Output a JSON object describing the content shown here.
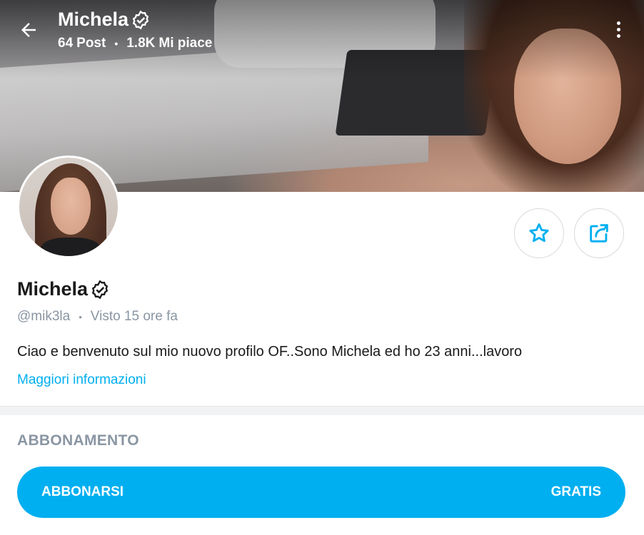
{
  "header": {
    "name": "Michela",
    "posts_count": "64",
    "posts_label": "Post",
    "separator": "•",
    "likes_count": "1.8K",
    "likes_label": "Mi piace"
  },
  "profile": {
    "name": "Michela",
    "handle": "@mik3la",
    "separator": "•",
    "last_seen": "Visto 15 ore fa",
    "bio": "Ciao e benvenuto sul mio nuovo profilo OF..Sono Michela ed ho 23 anni...lavoro",
    "more_info": "Maggiori informazioni"
  },
  "subscription": {
    "section_title": "ABBONAMENTO",
    "button_label": "ABBONARSI",
    "price_label": "GRATIS"
  },
  "colors": {
    "accent": "#00aff0",
    "muted_text": "#8a96a3"
  },
  "icons": {
    "back": "arrow-left-icon",
    "verified": "verified-badge-icon",
    "more": "more-vertical-icon",
    "favorite": "star-icon",
    "share": "share-icon"
  }
}
